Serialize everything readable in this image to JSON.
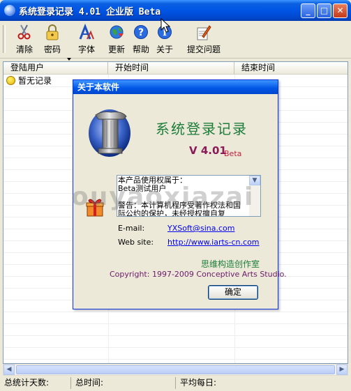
{
  "window": {
    "title": "系统登录记录 4.01 企业版 Beta",
    "controls": {
      "minimize": "_",
      "maximize": "□",
      "close": "✕"
    }
  },
  "toolbar": {
    "items": [
      {
        "label": "清除",
        "icon": "scissors-icon"
      },
      {
        "label": "密码",
        "icon": "padlock-icon"
      },
      {
        "label": "字体",
        "icon": "font-icon"
      },
      {
        "label": "更新",
        "icon": "globe-icon"
      },
      {
        "label": "帮助",
        "icon": "help-icon"
      },
      {
        "label": "关于",
        "icon": "info-icon"
      },
      {
        "label": "提交问题",
        "icon": "pen-icon"
      }
    ]
  },
  "list": {
    "columns": [
      "登陆用户",
      "开始时间",
      "结束时间"
    ],
    "rows": [
      {
        "user": "暂无记录"
      }
    ]
  },
  "status": {
    "total_days": "总统计天数:",
    "total_time": "总时间:",
    "daily_average": "平均每日:"
  },
  "about_dialog": {
    "title": "关于本软件",
    "app_name": "系统登录记录",
    "version": "V 4.01",
    "edition": "Beta",
    "license_text": "本产品使用权属于：\nBeta测试用户\n\n警告：本计算机程序受著作权法和国际公约的保护，未经授权擅自复",
    "email_label": "E-mail:",
    "email": "YXSoft@sina.com",
    "website_label": "Web site:",
    "website": "http://www.iarts-cn.com",
    "studio": "思维构造创作室",
    "copyright": "Copyright: 1997-2009 Conceptive Arts Studio.",
    "ok_label": "确定"
  },
  "watermark": "ouyaoxiazai",
  "colors": {
    "titlebar": "#0055e5",
    "dialog_app_name": "#1c7d3a",
    "dialog_version": "#8a1a5a",
    "link": "#0000ee"
  }
}
